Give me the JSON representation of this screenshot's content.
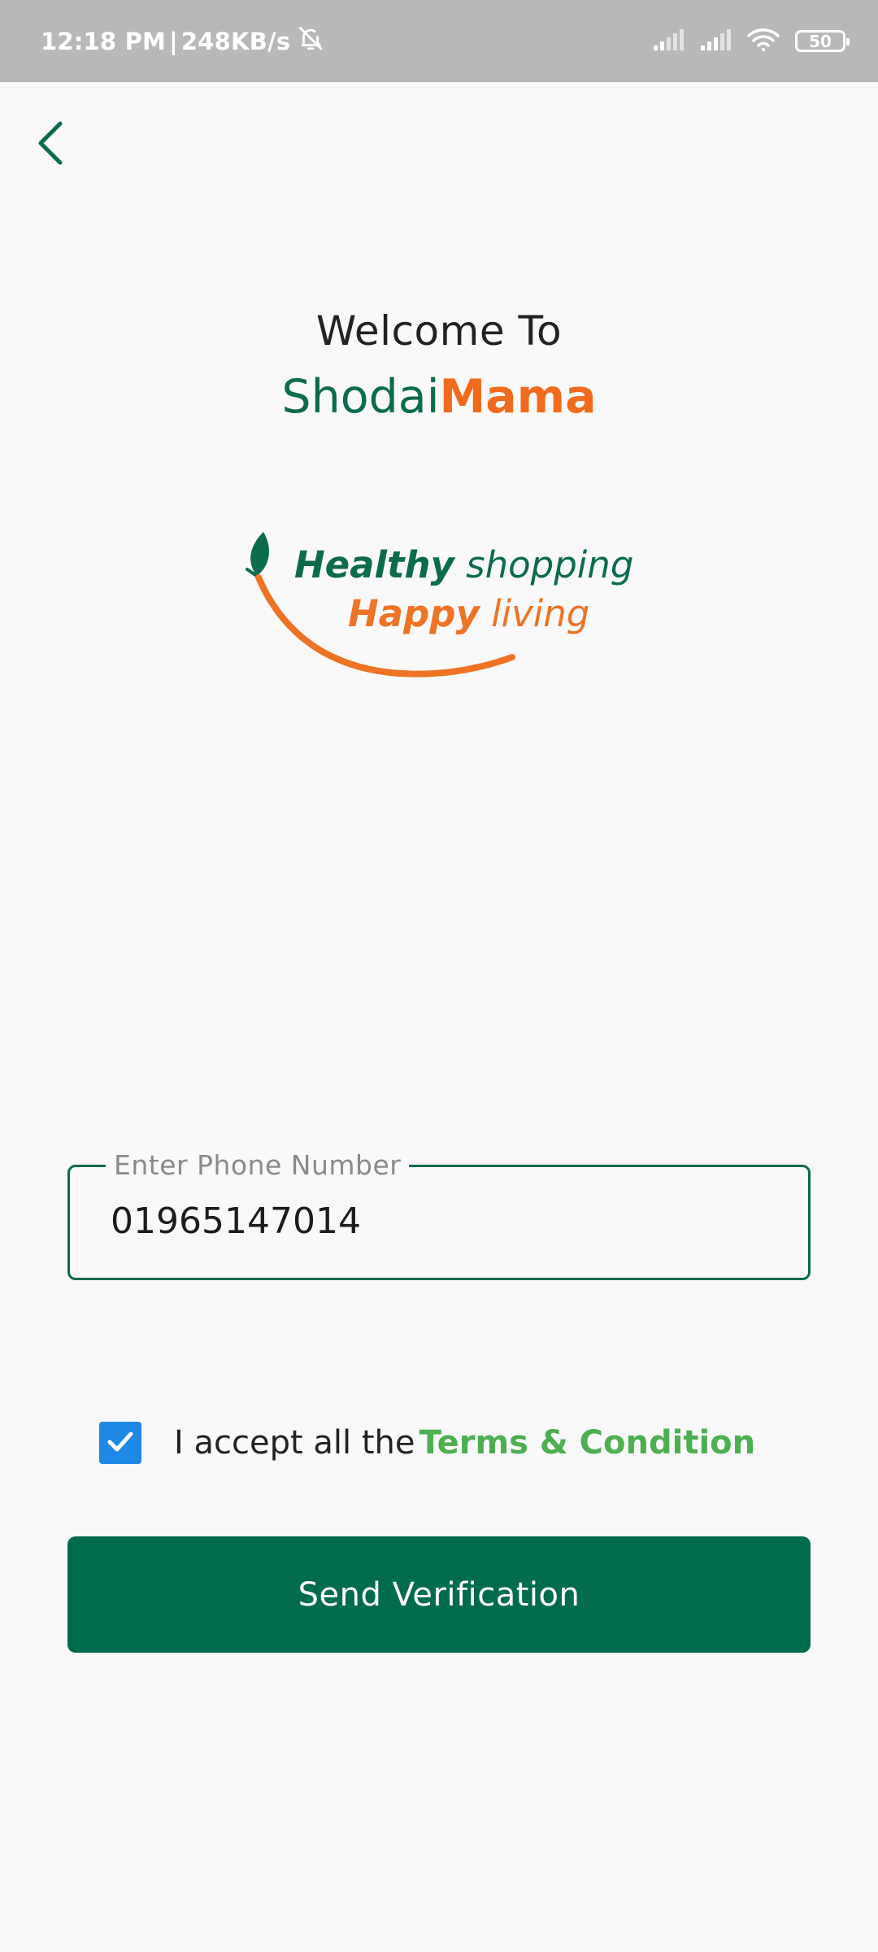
{
  "status_bar": {
    "time": "12:18 PM",
    "separator": "|",
    "speed": "248KB/s",
    "battery": "50",
    "icons": [
      "bell-off-icon",
      "signal-icon",
      "signal-icon",
      "wifi-icon",
      "battery-icon"
    ]
  },
  "nav": {
    "back_icon": "chevron-left-icon"
  },
  "welcome": {
    "line1": "Welcome To",
    "brand_part1": "Shodai",
    "brand_part2": "Mama"
  },
  "tagline": {
    "word1_bold": "Healthy",
    "word1_rest": "shopping",
    "word2_bold": "Happy",
    "word2_rest": "living"
  },
  "form": {
    "phone_label": "Enter Phone Number",
    "phone_value": "01965147014",
    "terms_checked": true,
    "terms_text": "I accept all the",
    "terms_link": "Terms & Condition",
    "submit_label": "Send Verification"
  },
  "colors": {
    "brand_green": "#0b6b4d",
    "brand_orange": "#f26b1d",
    "link_green": "#4caf50",
    "checkbox_blue": "#1e88e5",
    "button_green": "#016b4d"
  }
}
